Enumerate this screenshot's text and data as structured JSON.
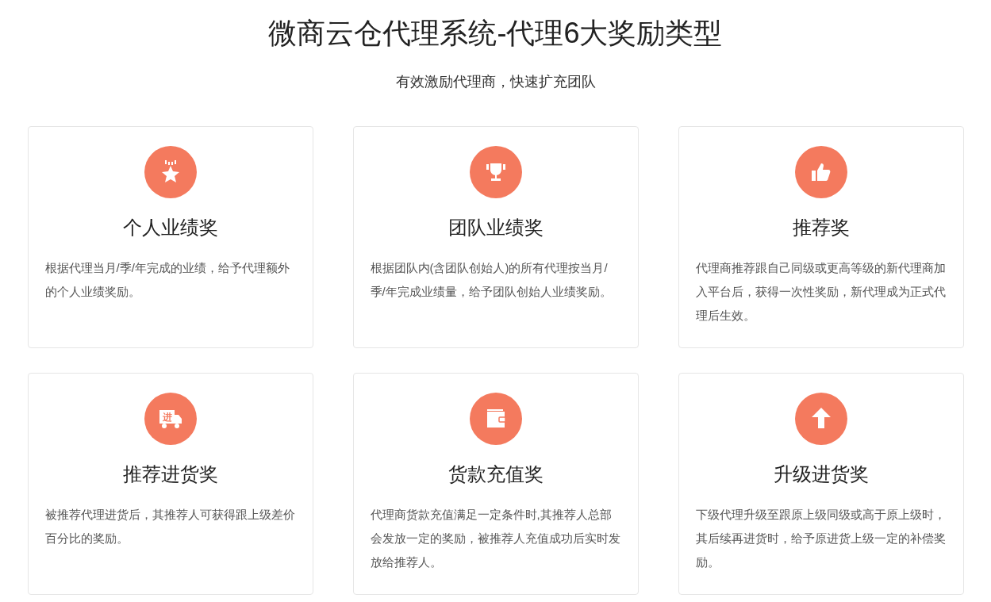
{
  "title": "微商云仓代理系统-代理6大奖励类型",
  "subtitle": "有效激励代理商，快速扩充团队",
  "cards": [
    {
      "kind": "star",
      "title": "个人业绩奖",
      "description": "根据代理当月/季/年完成的业绩，给予代理额外的个人业绩奖励。"
    },
    {
      "kind": "trophy",
      "title": "团队业绩奖",
      "description": "根据团队内(含团队创始人)的所有代理按当月/季/年完成业绩量，给予团队创始人业绩奖励。"
    },
    {
      "kind": "thumb",
      "title": "推荐奖",
      "description": "代理商推荐跟自己同级或更高等级的新代理商加入平台后，获得一次性奖励，新代理成为正式代理后生效。"
    },
    {
      "kind": "truck",
      "icon_label": "进",
      "title": "推荐进货奖",
      "description": "被推荐代理进货后，其推荐人可获得跟上级差价百分比的奖励。"
    },
    {
      "kind": "wallet",
      "title": "货款充值奖",
      "description": "代理商货款充值满足一定条件时,其推荐人总部会发放一定的奖励，被推荐人充值成功后实时发放给推荐人。"
    },
    {
      "kind": "arrow",
      "title": "升级进货奖",
      "description": "下级代理升级至跟原上级同级或高于原上级时，其后续再进货时，给予原进货上级一定的补偿奖励。"
    }
  ]
}
